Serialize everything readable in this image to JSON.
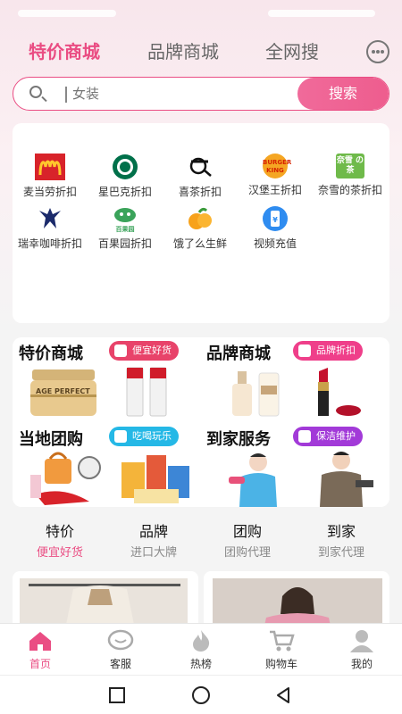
{
  "colors": {
    "accent": "#ea4d83",
    "accent_light": "#f06a9a"
  },
  "top_tabs": [
    "特价商城",
    "品牌商城",
    "全网搜"
  ],
  "search": {
    "placeholder": "女装",
    "button": "搜索"
  },
  "brands": [
    {
      "label": "麦当劳折扣",
      "icon": "mcdonalds-logo"
    },
    {
      "label": "星巴克折扣",
      "icon": "starbucks-logo"
    },
    {
      "label": "喜茶折扣",
      "icon": "heytea-logo"
    },
    {
      "label": "汉堡王折扣",
      "icon": "burger-king-logo"
    },
    {
      "label": "奈雪的茶折扣",
      "icon": "naixue-logo"
    },
    {
      "label": "瑞幸咖啡折扣",
      "icon": "luckin-logo"
    },
    {
      "label": "百果园折扣",
      "icon": "pagoda-logo"
    },
    {
      "label": "饿了么生鲜",
      "icon": "orange-fruit-icon"
    },
    {
      "label": "视频充值",
      "icon": "phone-recharge-icon"
    }
  ],
  "brand_logo_text": {
    "burger_king": "BURGER KING",
    "naixue": "奈雪 の茶",
    "pagoda": "百果园"
  },
  "promo": [
    {
      "title": "特价商城",
      "badge": "便宜好货",
      "badge_color": "#e8436a"
    },
    {
      "title": "品牌商城",
      "badge": "品牌折扣",
      "badge_color": "#ef3f8a"
    },
    {
      "title": "当地团购",
      "badge": "吃喝玩乐",
      "badge_color": "#25b8e6"
    },
    {
      "title": "到家服务",
      "badge": "保洁维护",
      "badge_color": "#a23ad8"
    }
  ],
  "product_texts": {
    "cream_jar": "AGE PERFECT"
  },
  "categories": [
    {
      "main": "特价",
      "sub": "便宜好货"
    },
    {
      "main": "品牌",
      "sub": "进口大牌"
    },
    {
      "main": "团购",
      "sub": "团购代理"
    },
    {
      "main": "到家",
      "sub": "到家代理"
    }
  ],
  "tabbar": [
    {
      "label": "首页",
      "icon": "home-icon"
    },
    {
      "label": "客服",
      "icon": "customer-service-icon"
    },
    {
      "label": "热榜",
      "icon": "flame-icon"
    },
    {
      "label": "购物车",
      "icon": "cart-icon"
    },
    {
      "label": "我的",
      "icon": "profile-icon"
    }
  ]
}
